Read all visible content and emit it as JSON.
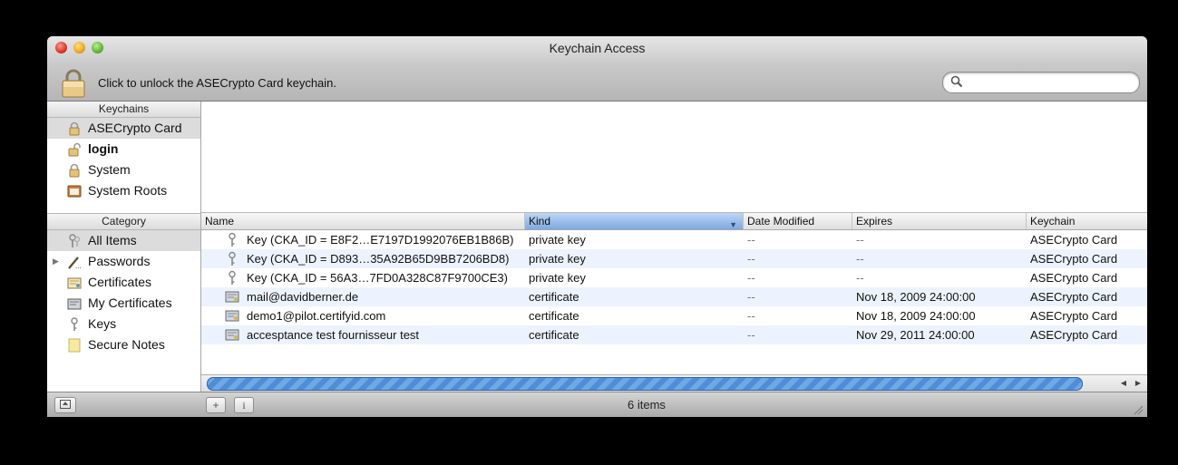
{
  "window": {
    "title": "Keychain Access"
  },
  "toolbar": {
    "unlock_text": "Click to unlock the ASECrypto Card keychain.",
    "search_placeholder": ""
  },
  "keychains": {
    "header": "Keychains",
    "items": [
      {
        "label": "ASECrypto Card",
        "icon": "padlock-closed-icon",
        "selected": true
      },
      {
        "label": "login",
        "icon": "padlock-open-icon",
        "bold": true
      },
      {
        "label": "System",
        "icon": "padlock-closed-icon"
      },
      {
        "label": "System Roots",
        "icon": "folder-cabinet-icon"
      }
    ]
  },
  "category": {
    "header": "Category",
    "items": [
      {
        "label": "All Items",
        "icon": "keys-icon",
        "selected": true
      },
      {
        "label": "Passwords",
        "icon": "pen-icon",
        "disclosure": true
      },
      {
        "label": "Certificates",
        "icon": "certificate-icon"
      },
      {
        "label": "My Certificates",
        "icon": "certificate-icon"
      },
      {
        "label": "Keys",
        "icon": "key-icon"
      },
      {
        "label": "Secure Notes",
        "icon": "note-icon"
      }
    ]
  },
  "table": {
    "columns": [
      "Name",
      "Kind",
      "Date Modified",
      "Expires",
      "Keychain"
    ],
    "sorted_column": "Kind",
    "rows": [
      {
        "icon": "key-icon",
        "name": "Key (CKA_ID = E8F2…E7197D1992076EB1B86B)",
        "kind": "private key",
        "modified": "--",
        "expires": "--",
        "keychain": "ASECrypto Card"
      },
      {
        "icon": "key-icon",
        "name": "Key (CKA_ID = D893…35A92B65D9BB7206BD8)",
        "kind": "private key",
        "modified": "--",
        "expires": "--",
        "keychain": "ASECrypto Card"
      },
      {
        "icon": "key-icon",
        "name": "Key (CKA_ID = 56A3…7FD0A328C87F9700CE3)",
        "kind": "private key",
        "modified": "--",
        "expires": "--",
        "keychain": "ASECrypto Card"
      },
      {
        "icon": "certificate-icon",
        "name": "mail@davidberner.de",
        "kind": "certificate",
        "modified": "--",
        "expires": "Nov 18, 2009 24:00:00",
        "keychain": "ASECrypto Card"
      },
      {
        "icon": "certificate-icon",
        "name": "demo1@pilot.certifyid.com",
        "kind": "certificate",
        "modified": "--",
        "expires": "Nov 18, 2009 24:00:00",
        "keychain": "ASECrypto Card"
      },
      {
        "icon": "certificate-icon",
        "name": "accesptance test fournisseur test",
        "kind": "certificate",
        "modified": "--",
        "expires": "Nov 29, 2011 24:00:00",
        "keychain": "ASECrypto Card"
      }
    ]
  },
  "status": {
    "count": "6 items",
    "add_label": "+",
    "info_label": "i"
  },
  "colors": {
    "selection": "#7fa9e0",
    "row_alt": "#edf3fe",
    "scroll_thumb": "#4e8ed6"
  }
}
